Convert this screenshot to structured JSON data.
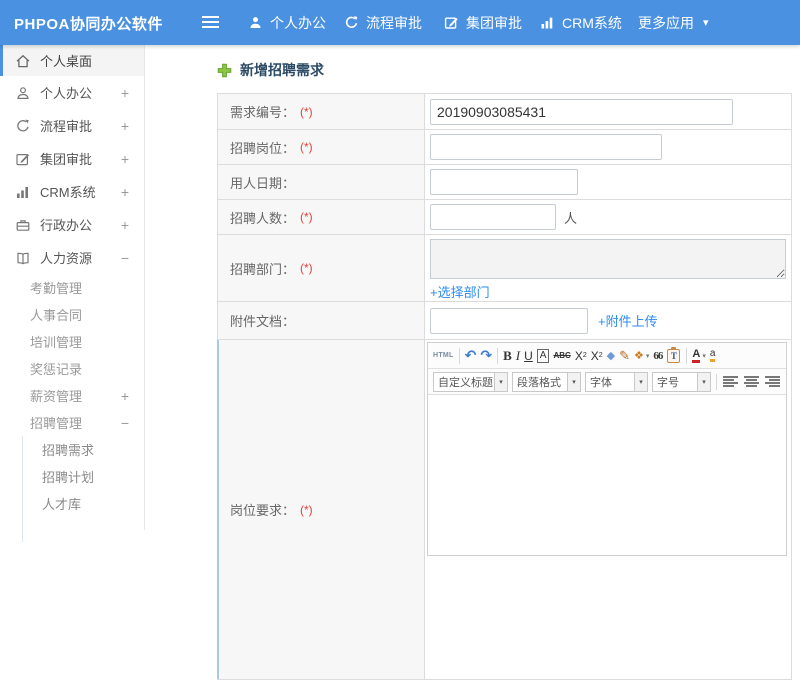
{
  "colors": {
    "topbar_bg": "#4a91e2",
    "link_blue": "#2d8cf0",
    "required_red": "#e5413a",
    "title_text": "#2c4a66",
    "add_icon_green": "#8dc63f"
  },
  "icons": {
    "undo": "↶",
    "redo": "↷",
    "eraser": "◆",
    "brush": "✎",
    "painter": "❖",
    "caret": "▾"
  },
  "topbar": {
    "logo": "PHPOA协同办公软件",
    "nav": [
      {
        "label": "个人办公",
        "icon": "user-icon"
      },
      {
        "label": "流程审批",
        "icon": "process-arrow-icon"
      },
      {
        "label": "集团审批",
        "icon": "edit-box-icon"
      },
      {
        "label": "CRM系统",
        "icon": "bar-chart-icon"
      },
      {
        "label": "更多应用",
        "icon": "chevron-down-icon"
      }
    ]
  },
  "sidebar": {
    "items": [
      {
        "label": "个人桌面",
        "icon": "home-icon",
        "active": true
      },
      {
        "label": "个人办公",
        "icon": "user-icon",
        "expander": "+"
      },
      {
        "label": "流程审批",
        "icon": "process-arrow-icon",
        "expander": "+"
      },
      {
        "label": "集团审批",
        "icon": "edit-box-icon",
        "expander": "+"
      },
      {
        "label": "CRM系统",
        "icon": "bar-chart-icon",
        "expander": "+"
      },
      {
        "label": "行政办公",
        "icon": "briefcase-icon",
        "expander": "+"
      },
      {
        "label": "人力资源",
        "icon": "book-icon",
        "expander": "−"
      }
    ],
    "subitems": [
      {
        "label": "考勤管理"
      },
      {
        "label": "人事合同"
      },
      {
        "label": "培训管理"
      },
      {
        "label": "奖惩记录"
      },
      {
        "label": "薪资管理",
        "expander": "+"
      },
      {
        "label": "招聘管理",
        "expander": "−"
      }
    ],
    "subsubitems": [
      {
        "label": "招聘需求"
      },
      {
        "label": "招聘计划"
      },
      {
        "label": "人才库"
      }
    ]
  },
  "main": {
    "title": "新增招聘需求",
    "form": {
      "rows": [
        {
          "label": "需求编号：",
          "required": "(*)",
          "value": "20190903085431"
        },
        {
          "label": "招聘岗位：",
          "required": "(*)"
        },
        {
          "label": "用人日期："
        },
        {
          "label": "招聘人数：",
          "required": "(*)",
          "suffix": "人"
        },
        {
          "label": "招聘部门：",
          "required": "(*)",
          "link": "+选择部门"
        },
        {
          "label": "附件文档：",
          "link": "+附件上传"
        },
        {
          "label": "岗位要求：",
          "required": "(*)"
        }
      ]
    },
    "editor": {
      "html_label": "HTML",
      "buttons": {
        "bold": "B",
        "italic": "I",
        "underline": "U",
        "charbox": "A",
        "strike": "ABC",
        "sup_base": "X",
        "sup_num": "2",
        "sub_base": "X",
        "sub_num": "2",
        "quote": "66",
        "clipboard_t": "T",
        "fontcolor": "A",
        "bgcolor": "a"
      },
      "dropdowns": [
        "自定义标题",
        "段落格式",
        "字体",
        "字号"
      ]
    }
  }
}
